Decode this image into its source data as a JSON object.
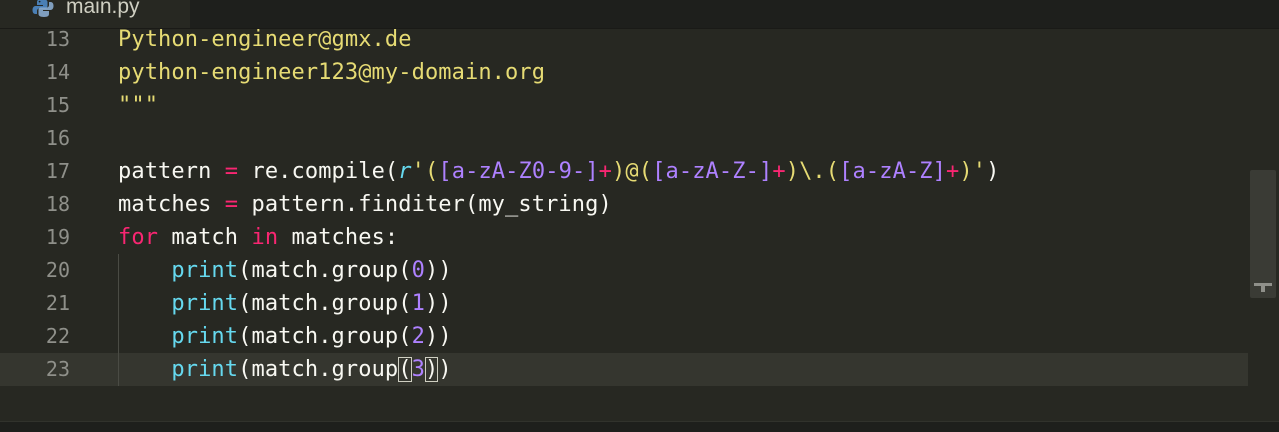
{
  "tab": {
    "filename": "main.py",
    "icon": "python-icon"
  },
  "lines": [
    {
      "number": "13",
      "text": "Python-engineer@gmx.de"
    },
    {
      "number": "14",
      "text": "python-engineer123@my-domain.org"
    },
    {
      "number": "15",
      "text": "\"\"\""
    },
    {
      "number": "16",
      "text": ""
    },
    {
      "number": "17",
      "text": "pattern = re.compile(r'([a-zA-Z0-9-]+)@([a-zA-Z-]+)\\.([a-zA-Z]+)')"
    },
    {
      "number": "18",
      "text": "matches = pattern.finditer(my_string)"
    },
    {
      "number": "19",
      "text": "for match in matches:"
    },
    {
      "number": "20",
      "text": "    print(match.group(0))"
    },
    {
      "number": "21",
      "text": "    print(match.group(1))"
    },
    {
      "number": "22",
      "text": "    print(match.group(2))"
    },
    {
      "number": "23",
      "text": "    print(match.group(3))"
    }
  ],
  "current_line": "23",
  "theme": {
    "background": "#272822",
    "string": "#e6db74",
    "keyword": "#f92672",
    "builtin": "#66d9ef",
    "number": "#ae81ff",
    "default": "#f8f8f2",
    "line_number": "#8f908a"
  }
}
